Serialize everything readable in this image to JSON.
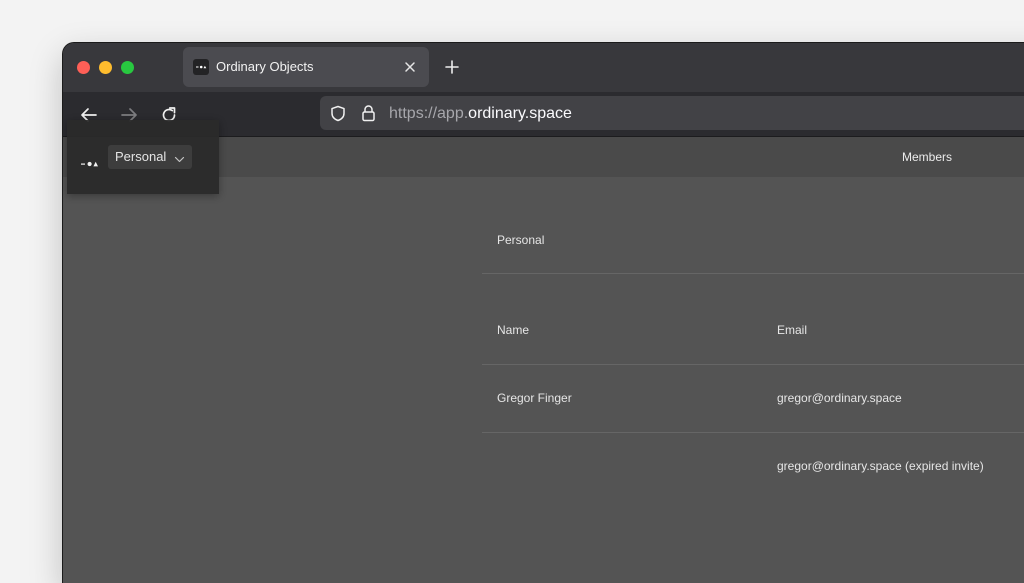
{
  "browser": {
    "tab": {
      "title": "Ordinary Objects"
    },
    "address": {
      "scheme_host_prefix": "https://app.",
      "domain": "ordinary.space"
    }
  },
  "app": {
    "workspace_selector": {
      "label": "Personal"
    },
    "nav": {
      "members_label": "Members"
    }
  },
  "members_page": {
    "workspace_title": "Personal",
    "table": {
      "columns": [
        "Name",
        "Email"
      ],
      "rows": [
        {
          "name": "Gregor Finger",
          "email": "gregor@ordinary.space"
        },
        {
          "name": "",
          "email": "gregor@ordinary.space (expired invite)"
        }
      ]
    }
  },
  "icons": {
    "tab_favicon": "ordinary-logo-icon",
    "tab_close": "close-icon",
    "new_tab": "plus-icon",
    "back": "arrow-left-icon",
    "forward": "arrow-right-icon",
    "reload": "reload-icon",
    "shield": "shield-icon",
    "lock": "lock-icon",
    "dropdown": "chevron-down-icon"
  },
  "colors": {
    "close": "#fe5f57",
    "minimize": "#febc2e",
    "zoom": "#28c840"
  }
}
